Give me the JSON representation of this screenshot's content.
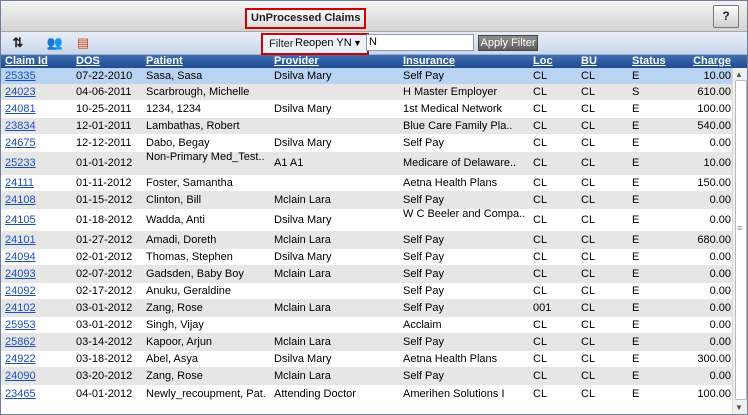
{
  "window": {
    "title": "UnProcessed Claims",
    "help_label": "?"
  },
  "toolbar": {
    "tools": [
      {
        "name": "sort-icon",
        "glyph": "⇅"
      },
      {
        "name": "user-assign-icon",
        "glyph": "👥"
      },
      {
        "name": "report-icon",
        "glyph": "▤"
      }
    ],
    "filter_label": "Filter",
    "filter_selected": "Reopen YN",
    "filter_value": "N",
    "apply_label": "Apply Filter"
  },
  "columns": [
    "Claim Id",
    "DOS",
    "Patient",
    "Provider",
    "Insurance",
    "Loc",
    "BU",
    "Status",
    "Charge"
  ],
  "rows": [
    {
      "id": "25335",
      "dos": "07-22-2010",
      "patient": "Sasa, Sasa",
      "provider": "Dsilva Mary",
      "insurance": "Self Pay",
      "loc": "CL",
      "bu": "CL",
      "status": "E",
      "charge": "10.00"
    },
    {
      "id": "24023",
      "dos": "04-06-2011",
      "patient": "Scarbrough, Michelle",
      "provider": "",
      "insurance": "H Master Employer",
      "loc": "CL",
      "bu": "CL",
      "status": "S",
      "charge": "610.00"
    },
    {
      "id": "24081",
      "dos": "10-25-2011",
      "patient": "1234, 1234",
      "provider": "Dsilva Mary",
      "insurance": "1st Medical Network",
      "loc": "CL",
      "bu": "CL",
      "status": "E",
      "charge": "100.00"
    },
    {
      "id": "23834",
      "dos": "12-01-2011",
      "patient": "Lambathas, Robert",
      "provider": "",
      "insurance": "Blue Care Family Pla..",
      "loc": "CL",
      "bu": "CL",
      "status": "E",
      "charge": "540.00"
    },
    {
      "id": "24675",
      "dos": "12-12-2011",
      "patient": "Dabo, Begay",
      "provider": "Dsilva Mary",
      "insurance": "Self Pay",
      "loc": "CL",
      "bu": "CL",
      "status": "E",
      "charge": "0.00"
    },
    {
      "id": "25233",
      "dos": "01-01-2012",
      "patient": "Non-Primary Med_Test..",
      "provider": "A1 A1",
      "insurance": "Medicare of Delaware..",
      "loc": "CL",
      "bu": "CL",
      "status": "E",
      "charge": "10.00"
    },
    {
      "id": "24111",
      "dos": "01-11-2012",
      "patient": "Foster, Samantha",
      "provider": "",
      "insurance": "Aetna Health Plans",
      "loc": "CL",
      "bu": "CL",
      "status": "E",
      "charge": "150.00"
    },
    {
      "id": "24108",
      "dos": "01-15-2012",
      "patient": "Clinton, Bill",
      "provider": "Mclain Lara",
      "insurance": "Self Pay",
      "loc": "CL",
      "bu": "CL",
      "status": "E",
      "charge": "0.00"
    },
    {
      "id": "24105",
      "dos": "01-18-2012",
      "patient": "Wadda, Anti",
      "provider": "Dsilva Mary",
      "insurance": "W C Beeler and Compa..",
      "loc": "CL",
      "bu": "CL",
      "status": "E",
      "charge": "0.00"
    },
    {
      "id": "24101",
      "dos": "01-27-2012",
      "patient": "Amadi, Doreth",
      "provider": "Mclain Lara",
      "insurance": "Self Pay",
      "loc": "CL",
      "bu": "CL",
      "status": "E",
      "charge": "680.00"
    },
    {
      "id": "24094",
      "dos": "02-01-2012",
      "patient": "Thomas, Stephen",
      "provider": "Dsilva Mary",
      "insurance": "Self Pay",
      "loc": "CL",
      "bu": "CL",
      "status": "E",
      "charge": "0.00"
    },
    {
      "id": "24093",
      "dos": "02-07-2012",
      "patient": "Gadsden, Baby Boy",
      "provider": "Mclain Lara",
      "insurance": "Self Pay",
      "loc": "CL",
      "bu": "CL",
      "status": "E",
      "charge": "0.00"
    },
    {
      "id": "24092",
      "dos": "02-17-2012",
      "patient": "Anuku, Geraldine",
      "provider": "",
      "insurance": "Self Pay",
      "loc": "CL",
      "bu": "CL",
      "status": "E",
      "charge": "0.00"
    },
    {
      "id": "24102",
      "dos": "03-01-2012",
      "patient": "Zang, Rose",
      "provider": "Mclain Lara",
      "insurance": "Self Pay",
      "loc": "001",
      "bu": "CL",
      "status": "E",
      "charge": "0.00"
    },
    {
      "id": "25953",
      "dos": "03-01-2012",
      "patient": "Singh, Vijay",
      "provider": "",
      "insurance": "Acclaim",
      "loc": "CL",
      "bu": "CL",
      "status": "E",
      "charge": "0.00"
    },
    {
      "id": "25862",
      "dos": "03-14-2012",
      "patient": "Kapoor, Arjun",
      "provider": "Mclain Lara",
      "insurance": "Self Pay",
      "loc": "CL",
      "bu": "CL",
      "status": "E",
      "charge": "0.00"
    },
    {
      "id": "24922",
      "dos": "03-18-2012",
      "patient": "Abel, Asya",
      "provider": "Dsilva Mary",
      "insurance": "Aetna Health Plans",
      "loc": "CL",
      "bu": "CL",
      "status": "E",
      "charge": "300.00"
    },
    {
      "id": "24090",
      "dos": "03-20-2012",
      "patient": "Zang, Rose",
      "provider": "Mclain Lara",
      "insurance": "Self Pay",
      "loc": "CL",
      "bu": "CL",
      "status": "E",
      "charge": "0.00"
    },
    {
      "id": "23465",
      "dos": "04-01-2012",
      "patient": "Newly_recoupment, Pat..",
      "provider": "Attending Doctor",
      "insurance": "Amerihen Solutions I",
      "loc": "CL",
      "bu": "CL",
      "status": "E",
      "charge": "100.00"
    }
  ],
  "colors": {
    "header": "#2b5aa0",
    "selected": "#b9d3f2",
    "stripe": "#e6e6e6",
    "link": "#1a4fc4",
    "highlight_border": "#d40000"
  }
}
